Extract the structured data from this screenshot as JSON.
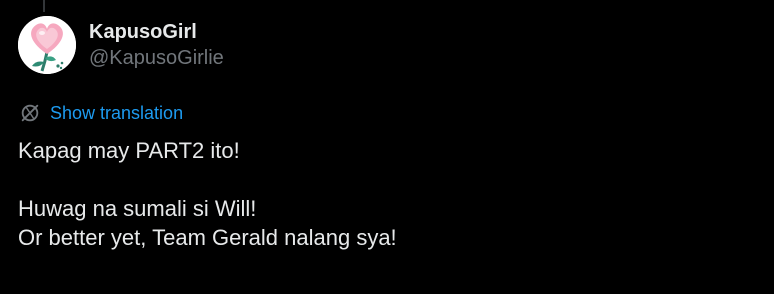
{
  "author": {
    "display_name": "KapusoGirl",
    "handle": "@KapusoGirlie",
    "avatar_icon": "heart-flower-avatar"
  },
  "translation": {
    "icon": "translate-globe-icon",
    "label": "Show translation",
    "color": "#1d9bf0"
  },
  "tweet": {
    "lines": [
      "Kapag may PART2 ito!",
      "",
      "Huwag na sumali si Will!",
      "Or better yet, Team Gerald nalang sya!"
    ]
  },
  "colors": {
    "background": "#000000",
    "text": "#e7e9ea",
    "secondary": "#71767b",
    "accent": "#1d9bf0"
  }
}
